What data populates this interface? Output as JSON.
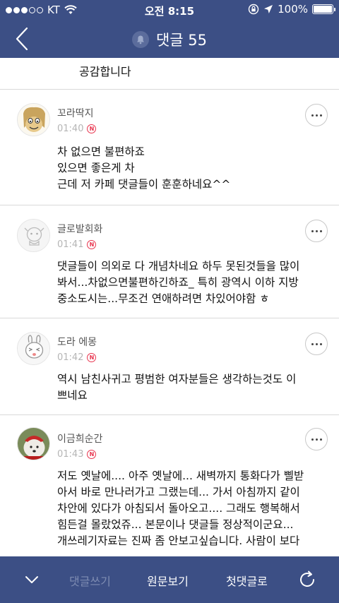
{
  "status_bar": {
    "carrier": "KT",
    "time": "오전 8:15",
    "battery": "100%"
  },
  "nav": {
    "title": "댓글 55"
  },
  "previous_comment_tail": "공감합니다",
  "comments": [
    {
      "nickname": "꼬라딱지",
      "time": "01:40",
      "badge": "N",
      "lines": [
        "차 없으면 불편하죠",
        "있으면 좋은게 차",
        "근데 저 카페 댓글들이 훈훈하네요^^"
      ]
    },
    {
      "nickname": "글로발회화",
      "time": "01:41",
      "badge": "N",
      "lines": [
        "댓글들이 의외로 다 개념차네요 하두 못된것들을 많이",
        "봐서...차없으면불편하긴하죠_ 특히 광역시 이하 지방",
        "중소도시는...무조건 연애하려면 차있어야함 ㅎ"
      ]
    },
    {
      "nickname": "도라 에몽",
      "time": "01:42",
      "badge": "N",
      "lines": [
        "역시 남친사귀고 평범한 여자분들은 생각하는것도 이",
        "쁘네요"
      ]
    },
    {
      "nickname": "이금희순간",
      "time": "01:43",
      "badge": "N",
      "lines": [
        "저도 옛날에.... 아주 옛날에... 새벽까지 통화다가 삘받",
        "아서 바로 만나러가고 그랬는데... 가서 아침까지 같이",
        "차안에 있다가 아침되서 돌아오고.... 그래도 행복해서",
        "힘든걸 몰랐었쥬... 본문이나 댓글들 정상적이군요...",
        "개쓰레기자료는 진짜 좀 안보고싶습니다. 사람이 보다"
      ]
    }
  ],
  "toolbar": {
    "write": "댓글쓰기",
    "original": "원문보기",
    "first": "첫댓글로"
  },
  "colors": {
    "primary": "#3c4f85",
    "new_badge": "#e8344e"
  }
}
